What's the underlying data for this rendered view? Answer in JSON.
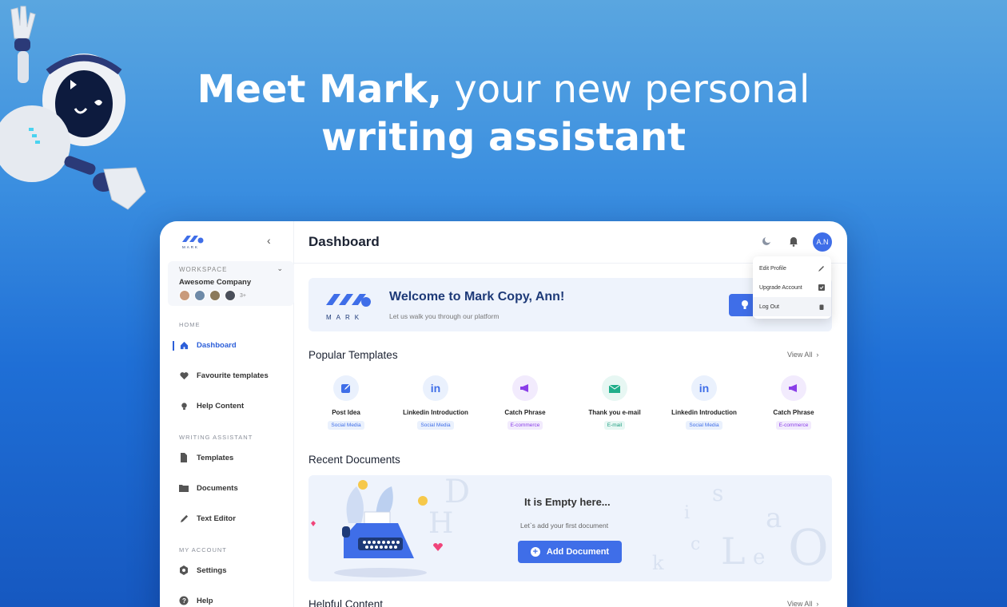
{
  "headline": {
    "bold1": "Meet Mark,",
    "light": "your new personal",
    "bold2": "writing assistant"
  },
  "sidebar": {
    "logo_text": "MARK",
    "workspace_label": "WORKSPACE",
    "workspace_name": "Awesome Company",
    "members_more": "3+",
    "sections": {
      "home": "HOME",
      "writing": "WRITING ASSISTANT",
      "account": "MY ACCOUNT"
    },
    "items": [
      {
        "label": "Dashboard",
        "icon": "home-icon"
      },
      {
        "label": "Favourite templates",
        "icon": "heart-icon"
      },
      {
        "label": "Help Content",
        "icon": "lightbulb-icon"
      },
      {
        "label": "Templates",
        "icon": "document-icon"
      },
      {
        "label": "Documents",
        "icon": "folder-icon"
      },
      {
        "label": "Text Editor",
        "icon": "pencil-icon"
      },
      {
        "label": "Settings",
        "icon": "gear-icon"
      },
      {
        "label": "Help",
        "icon": "help-icon"
      }
    ]
  },
  "header": {
    "title": "Dashboard",
    "user_initials": "A.N"
  },
  "user_menu": [
    {
      "label": "Edit Profile",
      "icon": "pencil-icon"
    },
    {
      "label": "Upgrade Account",
      "icon": "upgrade-icon"
    },
    {
      "label": "Log Out",
      "icon": "trash-icon"
    }
  ],
  "welcome": {
    "logo_text": "MARK",
    "title": "Welcome to Mark Copy, Ann!",
    "subtitle": "Let us walk you through our platform"
  },
  "popular": {
    "title": "Popular Templates",
    "view_all": "View All",
    "templates": [
      {
        "name": "Post Idea",
        "tag": "Social Media",
        "icon": "post-icon"
      },
      {
        "name": "Linkedin Introduction",
        "tag": "Social Media",
        "icon": "linkedin-icon"
      },
      {
        "name": "Catch Phrase",
        "tag": "E-commerce",
        "icon": "megaphone-icon"
      },
      {
        "name": "Thank you e-mail",
        "tag": "E-mail",
        "icon": "envelope-icon"
      },
      {
        "name": "Linkedin Introduction",
        "tag": "Social Media",
        "icon": "linkedin-icon"
      },
      {
        "name": "Catch Phrase",
        "tag": "E-commerce",
        "icon": "megaphone-icon"
      }
    ]
  },
  "recent": {
    "title": "Recent Documents",
    "empty_title": "It is Empty here...",
    "empty_sub": "Let`s add your first document",
    "add_button": "Add Document"
  },
  "helpful": {
    "title": "Helpful Content",
    "view_all": "View All"
  },
  "colors": {
    "accent": "#3f6ee8",
    "navy": "#1e3a78"
  }
}
